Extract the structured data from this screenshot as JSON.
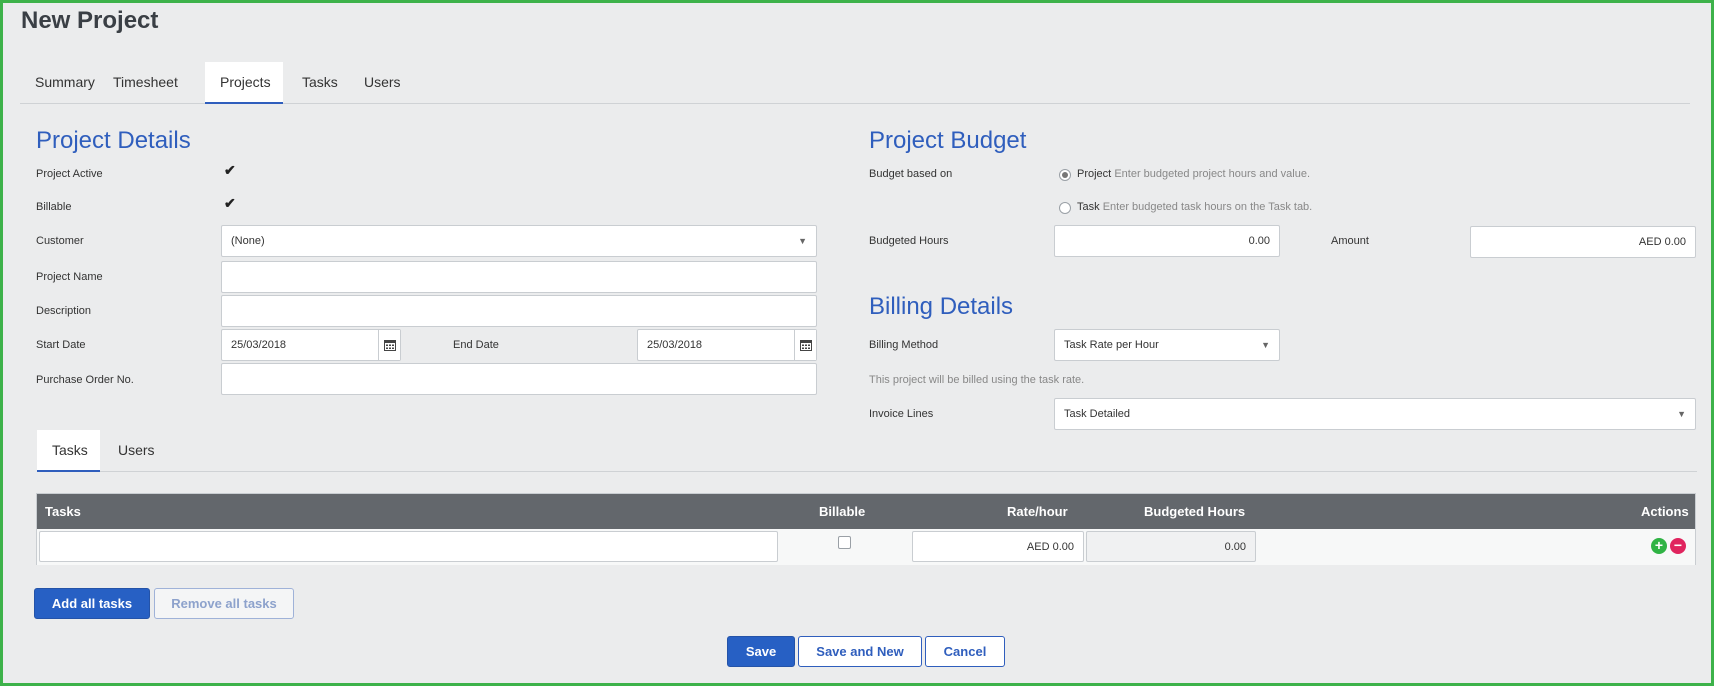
{
  "page": {
    "title": "New Project"
  },
  "tabs": [
    "Summary",
    "Timesheet",
    "Projects",
    "Tasks",
    "Users"
  ],
  "project_details": {
    "heading": "Project Details",
    "project_active_label": "Project Active",
    "billable_label": "Billable",
    "customer_label": "Customer",
    "customer_value": "(None)",
    "project_name_label": "Project Name",
    "project_name_value": "",
    "description_label": "Description",
    "description_value": "",
    "start_date_label": "Start Date",
    "start_date_value": "25/03/2018",
    "end_date_label": "End Date",
    "end_date_value": "25/03/2018",
    "po_label": "Purchase Order No.",
    "po_value": ""
  },
  "project_budget": {
    "heading": "Project Budget",
    "budget_based_on_label": "Budget based on",
    "option_project": "Project",
    "option_project_hint": "Enter budgeted project hours and value.",
    "option_task": "Task",
    "option_task_hint": "Enter budgeted task hours on the Task tab.",
    "budgeted_hours_label": "Budgeted Hours",
    "budgeted_hours_value": "0.00",
    "amount_label": "Amount",
    "amount_value": "AED 0.00"
  },
  "billing_details": {
    "heading": "Billing Details",
    "billing_method_label": "Billing Method",
    "billing_method_value": "Task Rate per Hour",
    "billing_note": "This project will be billed using the task rate.",
    "invoice_lines_label": "Invoice Lines",
    "invoice_lines_value": "Task Detailed"
  },
  "sub_tabs": [
    "Tasks",
    "Users"
  ],
  "task_grid": {
    "headers": {
      "tasks": "Tasks",
      "billable": "Billable",
      "rate": "Rate/hour",
      "budgeted_hours": "Budgeted Hours",
      "actions": "Actions"
    },
    "row": {
      "task": "",
      "rate": "AED 0.00",
      "budgeted_hours": "0.00"
    }
  },
  "buttons": {
    "add_all_tasks": "Add all tasks",
    "remove_all_tasks": "Remove all tasks",
    "save": "Save",
    "save_and_new": "Save and New",
    "cancel": "Cancel"
  }
}
